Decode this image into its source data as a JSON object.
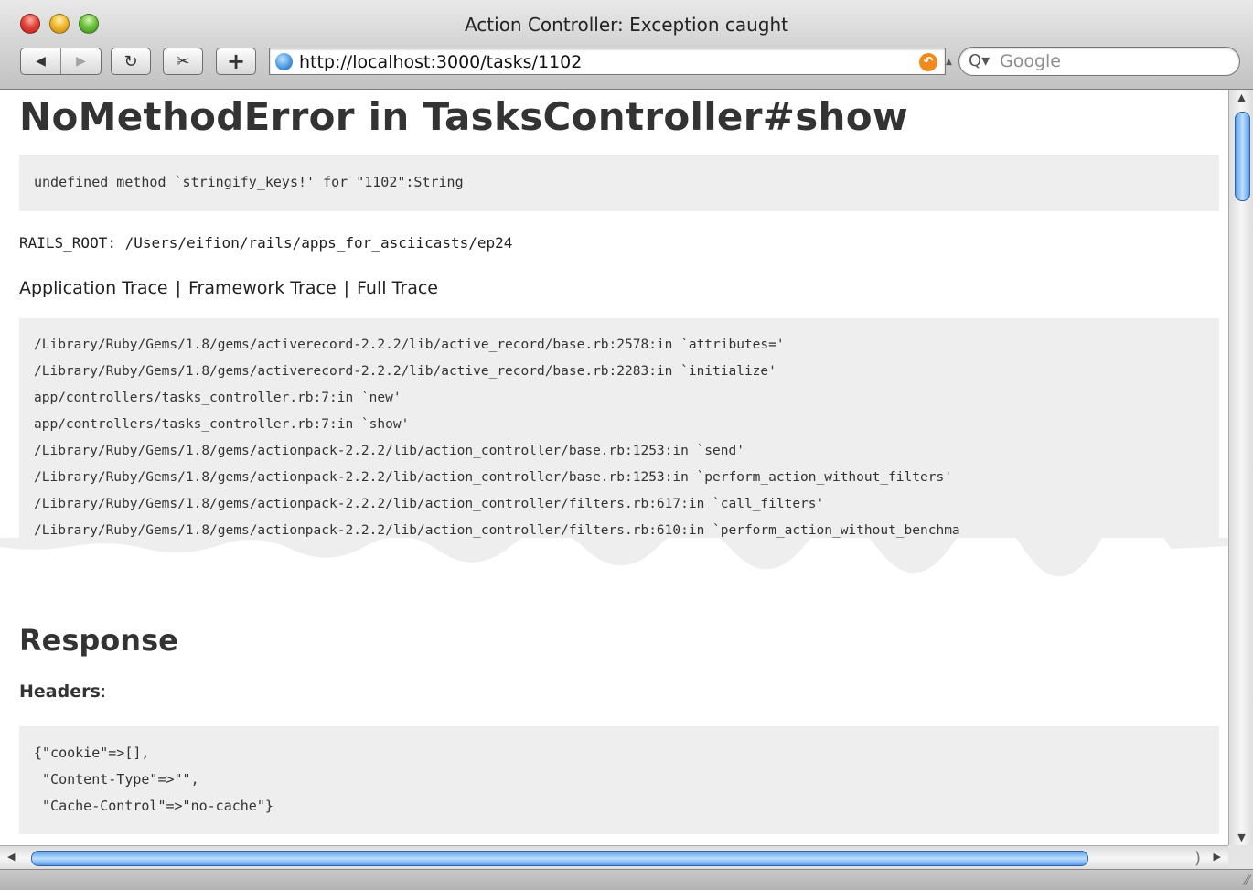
{
  "window": {
    "title": "Action Controller: Exception caught"
  },
  "toolbar": {
    "back_icon": "◀",
    "forward_icon": "▶",
    "reload_icon": "↻",
    "clip_icon": "✂",
    "add_icon": "+",
    "url": "http://localhost:3000/tasks/1102",
    "search_placeholder": "Google",
    "search_icon": "Q▾"
  },
  "page": {
    "heading": "NoMethodError in TasksController#show",
    "error_message": "undefined method `stringify_keys!' for \"1102\":String",
    "rails_root": "RAILS_ROOT: /Users/eifion/rails/apps_for_asciicasts/ep24",
    "trace_links": [
      "Application Trace",
      "Framework Trace",
      "Full Trace"
    ],
    "trace_separator": "|",
    "trace_lines": [
      "/Library/Ruby/Gems/1.8/gems/activerecord-2.2.2/lib/active_record/base.rb:2578:in `attributes='",
      "/Library/Ruby/Gems/1.8/gems/activerecord-2.2.2/lib/active_record/base.rb:2283:in `initialize'",
      "app/controllers/tasks_controller.rb:7:in `new'",
      "app/controllers/tasks_controller.rb:7:in `show'",
      "/Library/Ruby/Gems/1.8/gems/actionpack-2.2.2/lib/action_controller/base.rb:1253:in `send'",
      "/Library/Ruby/Gems/1.8/gems/actionpack-2.2.2/lib/action_controller/base.rb:1253:in `perform_action_without_filters'",
      "/Library/Ruby/Gems/1.8/gems/actionpack-2.2.2/lib/action_controller/filters.rb:617:in `call_filters'",
      "/Library/Ruby/Gems/1.8/gems/actionpack-2.2.2/lib/action_controller/filters.rb:610:in `perform_action_without_benchma"
    ],
    "response_heading": "Response",
    "headers_label": "Headers",
    "headers_colon": ":",
    "headers_lines": [
      "{\"cookie\"=>[],",
      " \"Content-Type\"=>\"\",",
      " \"Cache-Control\"=>\"no-cache\"}"
    ]
  }
}
